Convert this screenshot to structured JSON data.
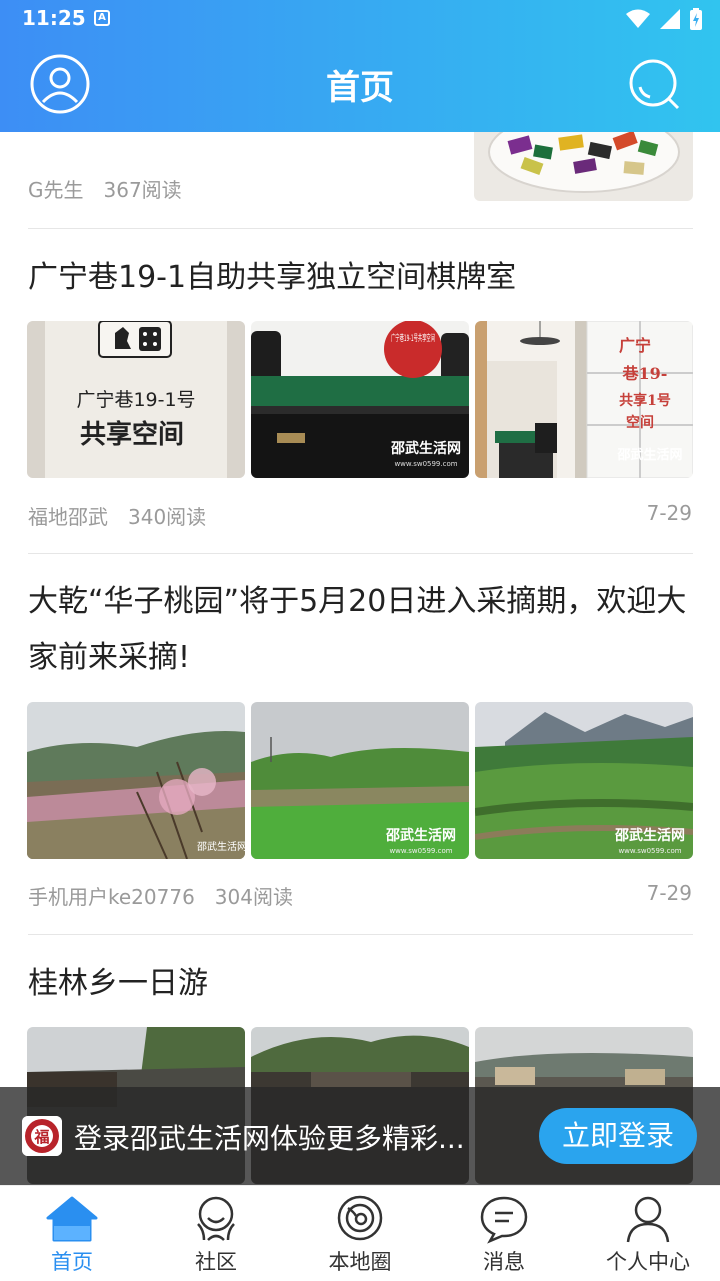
{
  "status": {
    "time": "11:25",
    "a_label": "A"
  },
  "header": {
    "title": "首页"
  },
  "articles": [
    {
      "author": "G先生",
      "reads": "367阅读"
    },
    {
      "title": "广宁巷19-1自助共享独立空间棋牌室",
      "author": "福地邵武",
      "reads": "340阅读",
      "date": "7-29",
      "thumb_texts": {
        "sign_line1": "广宁巷19-1号",
        "sign_line2": "共享空间",
        "stamp": "广宁巷19-1号共享空间",
        "watermark": "邵武生活网",
        "watermark_url": "www.sw0599.com"
      }
    },
    {
      "title_line1": "大乾“华子桃园”将于5月20日进入采摘期，欢迎大",
      "title_line2": "家前来采摘!",
      "author": "手机用户ke20776",
      "reads": "304阅读",
      "date": "7-29",
      "thumb_texts": {
        "watermark": "邵武生活网",
        "watermark_url": "www.sw0599.com"
      }
    },
    {
      "title": "桂林乡一日游"
    }
  ],
  "login_banner": {
    "text": "登录邵武生活网体验更多精彩...",
    "button": "立即登录"
  },
  "nav": [
    {
      "label": "首页",
      "icon": "home-icon",
      "active": true
    },
    {
      "label": "社区",
      "icon": "community-icon",
      "active": false
    },
    {
      "label": "本地圈",
      "icon": "local-circle-icon",
      "active": false
    },
    {
      "label": "消息",
      "icon": "message-icon",
      "active": false
    },
    {
      "label": "个人中心",
      "icon": "profile-icon",
      "active": false
    }
  ],
  "colors": {
    "accent": "#2a8ff0",
    "header_start": "#3d8ef5",
    "header_end": "#31c4ef",
    "login_button": "#2aa4ee"
  }
}
